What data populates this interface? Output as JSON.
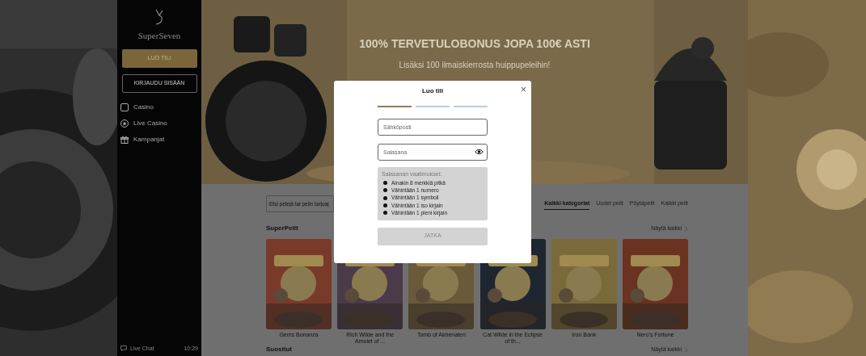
{
  "sidebar": {
    "logo": "SuperSeven",
    "primary_button": "LUO TILI",
    "secondary_button": "KIRJAUDU SISÄÄN",
    "items": [
      {
        "label": "Casino"
      },
      {
        "label": "Live Casino"
      },
      {
        "label": "Kampanjat"
      }
    ],
    "live_chat": "Live Chat",
    "clock": "10:29"
  },
  "hero": {
    "title": "100% TERVETULOBONUS JOPA 100€ ASTI",
    "subtitle": "Lisäksi 100 ilmaiskierrosta huippupeleihin!"
  },
  "search": {
    "placeholder": "Etsi pelejä tai pelin tarjoaj"
  },
  "category_tabs": [
    {
      "label": "Kaikki kategoriat",
      "selected": true
    },
    {
      "label": "Uudet pelit",
      "selected": false
    },
    {
      "label": "Pöytäpelit",
      "selected": false
    },
    {
      "label": "Kaikki pelit",
      "selected": false
    }
  ],
  "sections": [
    {
      "title": "SuperPelit",
      "link": "Näytä kaikki",
      "games": [
        {
          "name": "Gems Bonanza"
        },
        {
          "name": "Rich Wilde and the Amulet of ..."
        },
        {
          "name": "Tomb of Akhenaten"
        },
        {
          "name": "Cat Wilde in the Eclipse of th..."
        },
        {
          "name": "Iron Bank"
        },
        {
          "name": "Nero's Fortune"
        }
      ]
    },
    {
      "title": "Suositut",
      "link": "Näytä kaikki"
    }
  ],
  "modal": {
    "title": "Luo tili",
    "close": "×",
    "steps": [
      {
        "selected": true
      },
      {
        "selected": false
      },
      {
        "selected": false
      }
    ],
    "fields": [
      {
        "placeholder": "Sähköposti",
        "kind": "text"
      },
      {
        "placeholder": "Salasana",
        "kind": "password"
      }
    ],
    "requirements": {
      "title": "Salasanan vaatimukset:",
      "items": [
        "Ainakin 8 merkkiä pitkä",
        "Vähintään 1 numero",
        "Vähintään 1 symboli",
        "Vähintään 1 iso kirjain",
        "Vähintään 1 pieni kirjain"
      ]
    },
    "submit": {
      "label": "JATKA",
      "disabled": true
    }
  }
}
